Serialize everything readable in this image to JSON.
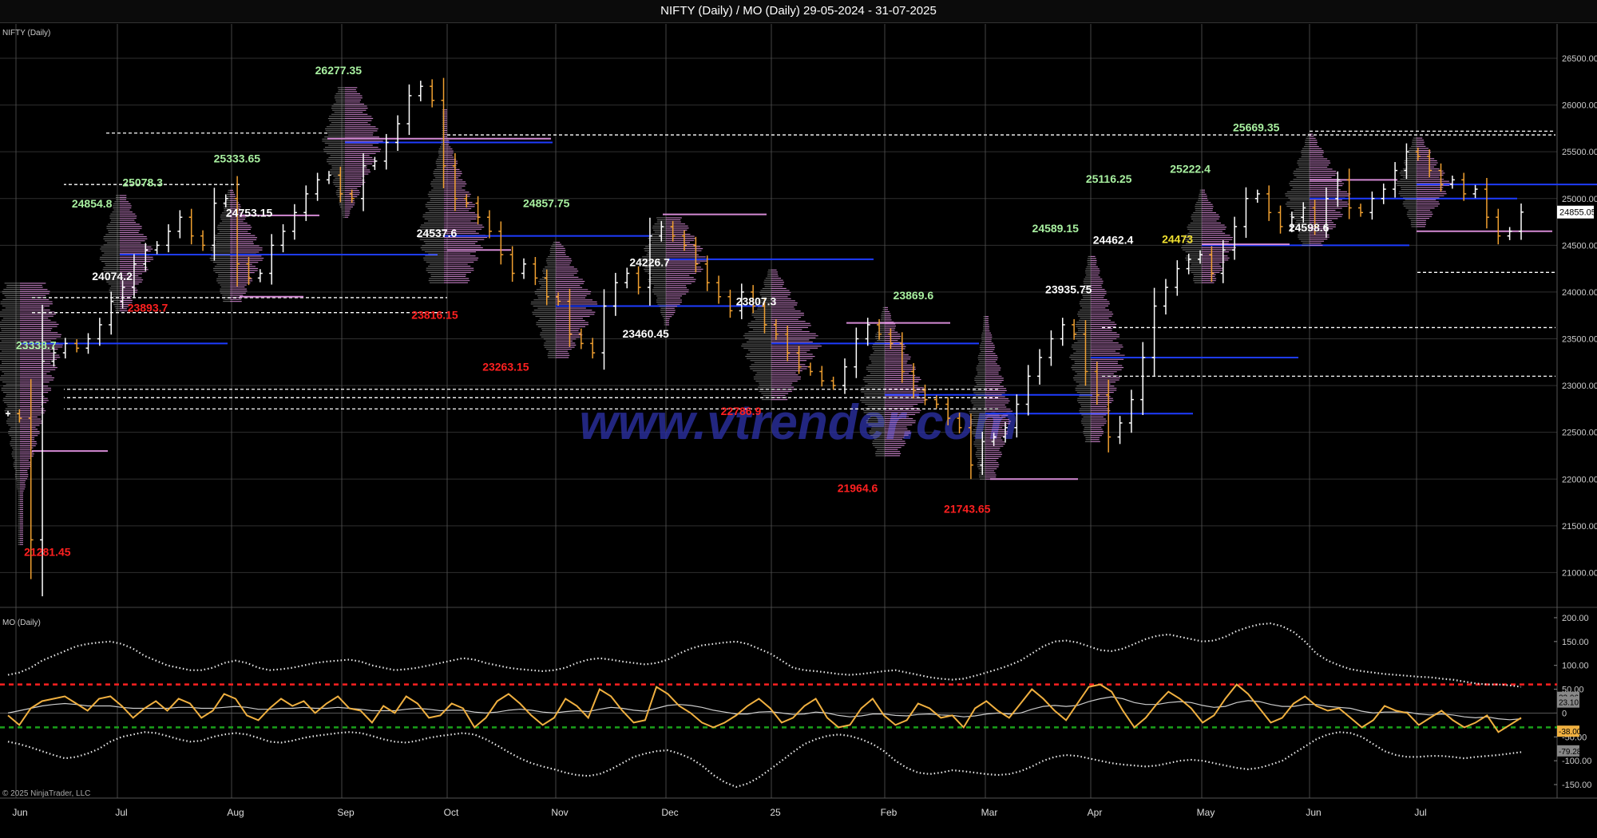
{
  "title": "NIFTY (Daily) / MO (Daily)  29-05-2024 - 31-07-2025",
  "watermark": "www.vtrender.com",
  "copyright": "© 2025 NinjaTrader, LLC",
  "colors": {
    "background": "#000000",
    "grid": "#555555",
    "up_bar": "#ffffff",
    "down_bar": "#f0a030",
    "profile": "#d48ad4",
    "poc": "#1e3cff",
    "high_label": "#a8f0a0",
    "low_label": "#ff2020",
    "mo_line": "#f0b040",
    "overbought": "#ff2020",
    "oversold": "#1aa01a",
    "watermark": "#2a30a0"
  },
  "chart_data": [
    {
      "type": "line",
      "panel": "price",
      "label": "NIFTY (Daily)",
      "ylim": [
        20850,
        26850
      ],
      "y_ticks": [
        "26500.00",
        "26000.00",
        "25500.00",
        "25000.00",
        "24500.00",
        "24000.00",
        "23500.00",
        "23000.00",
        "22500.00",
        "22000.00",
        "21500.00",
        "21000.00"
      ],
      "months": [
        "Jun",
        "Jul",
        "Aug",
        "Sep",
        "Oct",
        "Nov",
        "Dec",
        "25",
        "Feb",
        "Mar",
        "Apr",
        "May",
        "Jun",
        "Jul"
      ],
      "last_price": "24855.05",
      "series": [
        {
          "values": [
            22700,
            22650,
            21350,
            23260,
            23350,
            23450,
            23400,
            23500,
            23650,
            23900,
            24050,
            24300,
            24450,
            24500,
            24650,
            24800,
            24600,
            24500,
            24950,
            25000,
            24300,
            24150,
            24200,
            24500,
            24650,
            24850,
            25050,
            25200,
            25250,
            25050,
            25000,
            25350,
            25400,
            25600,
            25800,
            26100,
            26200,
            26050,
            25350,
            25000,
            24950,
            24800,
            24650,
            24400,
            24200,
            24300,
            24150,
            23950,
            23900,
            23550,
            23450,
            23350,
            23850,
            24100,
            24200,
            24050,
            24600,
            24700,
            24600,
            24500,
            24300,
            24100,
            23950,
            23800,
            24000,
            23850,
            23650,
            23550,
            23350,
            23200,
            23150,
            23050,
            23000,
            23200,
            23500,
            23650,
            23550,
            23450,
            23150,
            22950,
            22850,
            22800,
            22650,
            22550,
            22150,
            22400,
            22450,
            22550,
            22800,
            23100,
            23300,
            23500,
            23650,
            23550,
            23150,
            22900,
            22450,
            22600,
            22850,
            23300,
            23850,
            24050,
            24250,
            24350,
            24400,
            24200,
            24450,
            24700,
            25000,
            25050,
            24850,
            24700,
            24800,
            24900,
            24700,
            25000,
            25200,
            24900,
            24850,
            25000,
            25100,
            25300,
            25500,
            25450,
            25300,
            25150,
            25200,
            25050,
            25100,
            24800,
            24600,
            24650,
            24855
          ]
        }
      ],
      "annotations": [
        {
          "text": "21281.45",
          "kind": "low",
          "month": 0.08,
          "price": 21281.45
        },
        {
          "text": "23338.7",
          "kind": "high",
          "month": 0.0,
          "price": 23338.7
        },
        {
          "text": "24854.8",
          "kind": "high",
          "month": 0.55,
          "price": 24854.8
        },
        {
          "text": "24074.2",
          "kind": "level",
          "month": 0.75,
          "price": 24074.2
        },
        {
          "text": "25078.3",
          "kind": "high",
          "month": 1.05,
          "price": 25078.3
        },
        {
          "text": "23893.7",
          "kind": "low",
          "month": 1.1,
          "price": 23893.7
        },
        {
          "text": "25333.65",
          "kind": "high",
          "month": 1.95,
          "price": 25333.65
        },
        {
          "text": "24753.15",
          "kind": "level",
          "month": 2.07,
          "price": 24753.15
        },
        {
          "text": "26277.35",
          "kind": "high",
          "month": 2.95,
          "price": 26277.35
        },
        {
          "text": "24537.6",
          "kind": "level",
          "month": 3.95,
          "price": 24537.6
        },
        {
          "text": "23816.15",
          "kind": "low",
          "month": 3.9,
          "price": 23816.15
        },
        {
          "text": "23263.15",
          "kind": "low",
          "month": 4.6,
          "price": 23263.15
        },
        {
          "text": "24857.75",
          "kind": "high",
          "month": 5.0,
          "price": 24857.75
        },
        {
          "text": "24226.7",
          "kind": "level",
          "month": 6.05,
          "price": 24226.7
        },
        {
          "text": "23460.45",
          "kind": "level",
          "month": 5.98,
          "price": 23460.45
        },
        {
          "text": "22786.9",
          "kind": "low",
          "month": 6.95,
          "price": 22786.9
        },
        {
          "text": "23807.3",
          "kind": "level",
          "month": 7.1,
          "price": 23807.3
        },
        {
          "text": "21964.6",
          "kind": "low",
          "month": 8.1,
          "price": 21964.6
        },
        {
          "text": "23869.6",
          "kind": "high",
          "month": 8.65,
          "price": 23869.6
        },
        {
          "text": "21743.65",
          "kind": "low",
          "month": 9.15,
          "price": 21743.65
        },
        {
          "text": "24589.15",
          "kind": "high",
          "month": 10.02,
          "price": 24589.15
        },
        {
          "text": "23935.75",
          "kind": "level",
          "month": 10.15,
          "price": 23935.75
        },
        {
          "text": "25116.25",
          "kind": "high",
          "month": 10.55,
          "price": 25116.25
        },
        {
          "text": "24462.4",
          "kind": "level",
          "month": 10.62,
          "price": 24462.4
        },
        {
          "text": "25222.4",
          "kind": "high",
          "month": 11.38,
          "price": 25222.4
        },
        {
          "text": "24473",
          "kind": "yellow",
          "month": 11.3,
          "price": 24473
        },
        {
          "text": "25669.35",
          "kind": "high",
          "month": 12.0,
          "price": 25669.35
        },
        {
          "text": "24598.6",
          "kind": "level",
          "month": 12.55,
          "price": 24598.6
        }
      ]
    },
    {
      "type": "line",
      "panel": "oscillator",
      "label": "MO (Daily)",
      "ylim": [
        -170,
        215
      ],
      "y_ticks": [
        "200.00",
        "150.00",
        "100.00",
        "50.00",
        "0",
        "-50.00",
        "-100.00",
        "-150.00"
      ],
      "levels": [
        60,
        -30
      ],
      "value_labels": [
        "33.06",
        "23.10",
        "-38.00",
        "-79.28"
      ],
      "series": [
        {
          "name": "MO",
          "values": [
            -5,
            -25,
            10,
            25,
            30,
            35,
            20,
            5,
            30,
            35,
            15,
            -10,
            10,
            25,
            5,
            30,
            20,
            -10,
            5,
            40,
            30,
            -5,
            -15,
            10,
            30,
            15,
            25,
            0,
            20,
            35,
            10,
            5,
            -20,
            15,
            0,
            35,
            20,
            -10,
            -5,
            20,
            10,
            -30,
            -10,
            25,
            40,
            20,
            -5,
            -25,
            -10,
            30,
            15,
            -10,
            50,
            35,
            5,
            -20,
            -15,
            55,
            40,
            15,
            0,
            -20,
            -30,
            -20,
            -5,
            15,
            30,
            10,
            -20,
            -10,
            15,
            30,
            -10,
            -30,
            -25,
            10,
            30,
            -5,
            -25,
            -15,
            20,
            10,
            -10,
            -5,
            -30,
            10,
            25,
            5,
            -10,
            20,
            50,
            30,
            5,
            -15,
            20,
            55,
            60,
            45,
            5,
            -30,
            -10,
            20,
            45,
            30,
            10,
            -20,
            -5,
            30,
            60,
            40,
            10,
            -20,
            -10,
            20,
            35,
            15,
            5,
            10,
            -10,
            -30,
            -15,
            15,
            5,
            0,
            -25,
            -10,
            5,
            -15,
            -30,
            -20,
            -5,
            -40,
            -25,
            -10
          ]
        },
        {
          "name": "Signal",
          "values": [
            0,
            5,
            10,
            15,
            18,
            20,
            18,
            15,
            15,
            15,
            12,
            10,
            10,
            10,
            10,
            12,
            12,
            10,
            10,
            12,
            14,
            12,
            8,
            8,
            10,
            10,
            12,
            10,
            10,
            12,
            10,
            8,
            5,
            5,
            5,
            8,
            10,
            8,
            5,
            6,
            6,
            2,
            0,
            2,
            6,
            8,
            6,
            2,
            0,
            3,
            5,
            3,
            8,
            12,
            10,
            6,
            4,
            10,
            16,
            18,
            16,
            12,
            6,
            2,
            -2,
            -2,
            2,
            3,
            0,
            -3,
            -2,
            2,
            0,
            -5,
            -8,
            -6,
            -2,
            -2,
            -5,
            -6,
            -3,
            -2,
            -4,
            -5,
            -8,
            -6,
            -2,
            0,
            -2,
            0,
            8,
            14,
            16,
            14,
            16,
            24,
            30,
            34,
            30,
            22,
            18,
            18,
            22,
            24,
            22,
            16,
            12,
            14,
            22,
            26,
            24,
            18,
            14,
            14,
            18,
            18,
            14,
            12,
            10,
            4,
            0,
            2,
            2,
            2,
            -2,
            -4,
            -2,
            -4,
            -8,
            -10,
            -8,
            -12,
            -14,
            -12
          ]
        },
        {
          "name": "Upper band",
          "values": [
            80,
            85,
            95,
            110,
            120,
            130,
            140,
            145,
            148,
            150,
            145,
            135,
            120,
            110,
            100,
            95,
            90,
            90,
            95,
            105,
            110,
            105,
            95,
            90,
            92,
            95,
            100,
            105,
            108,
            110,
            112,
            108,
            100,
            95,
            90,
            92,
            95,
            100,
            105,
            110,
            115,
            112,
            105,
            100,
            95,
            92,
            90,
            88,
            90,
            95,
            105,
            112,
            115,
            112,
            108,
            105,
            102,
            105,
            112,
            125,
            135,
            142,
            145,
            148,
            150,
            145,
            135,
            125,
            110,
            95,
            90,
            88,
            85,
            82,
            80,
            82,
            85,
            88,
            90,
            85,
            80,
            75,
            72,
            70,
            72,
            78,
            85,
            92,
            100,
            110,
            125,
            140,
            150,
            152,
            148,
            140,
            132,
            130,
            135,
            145,
            155,
            162,
            165,
            160,
            155,
            150,
            152,
            160,
            172,
            180,
            186,
            188,
            182,
            170,
            150,
            125,
            110,
            100,
            92,
            88,
            85,
            82,
            80,
            78,
            76,
            75,
            72,
            70,
            66,
            62,
            60,
            60,
            58,
            55
          ]
        },
        {
          "name": "Lower band",
          "values": [
            -60,
            -65,
            -72,
            -80,
            -88,
            -95,
            -92,
            -85,
            -75,
            -60,
            -50,
            -45,
            -40,
            -42,
            -48,
            -55,
            -60,
            -58,
            -50,
            -45,
            -42,
            -45,
            -52,
            -60,
            -62,
            -58,
            -52,
            -48,
            -45,
            -42,
            -40,
            -42,
            -48,
            -55,
            -60,
            -62,
            -58,
            -52,
            -48,
            -45,
            -42,
            -45,
            -55,
            -68,
            -82,
            -95,
            -105,
            -112,
            -118,
            -125,
            -130,
            -132,
            -128,
            -118,
            -105,
            -92,
            -85,
            -80,
            -78,
            -85,
            -95,
            -110,
            -130,
            -145,
            -155,
            -148,
            -135,
            -118,
            -100,
            -82,
            -65,
            -55,
            -48,
            -45,
            -48,
            -55,
            -65,
            -80,
            -100,
            -115,
            -125,
            -128,
            -125,
            -120,
            -122,
            -125,
            -128,
            -130,
            -128,
            -122,
            -112,
            -100,
            -92,
            -88,
            -90,
            -95,
            -100,
            -105,
            -108,
            -110,
            -112,
            -110,
            -105,
            -100,
            -98,
            -100,
            -105,
            -110,
            -115,
            -118,
            -115,
            -108,
            -100,
            -85,
            -70,
            -55,
            -45,
            -40,
            -42,
            -50,
            -65,
            -80,
            -88,
            -92,
            -92,
            -90,
            -90,
            -92,
            -95,
            -92,
            -90,
            -88,
            -85,
            -82
          ]
        }
      ]
    }
  ]
}
